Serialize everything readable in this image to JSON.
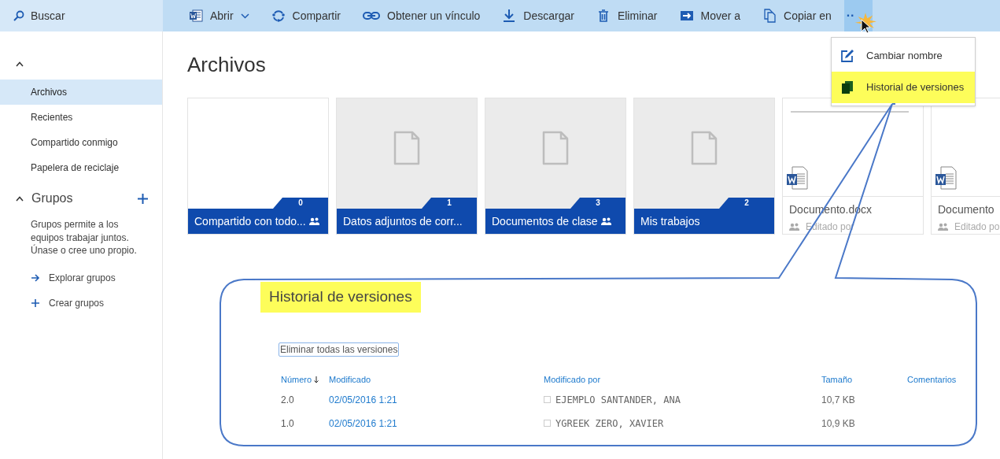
{
  "search": {
    "label": "Buscar"
  },
  "toolbar": [
    {
      "kind": "word",
      "label": "Abrir",
      "dropdown": true
    },
    {
      "kind": "share",
      "label": "Compartir",
      "dropdown": false
    },
    {
      "kind": "link",
      "label": "Obtener un vínculo",
      "dropdown": false
    },
    {
      "kind": "download",
      "label": "Descargar",
      "dropdown": false
    },
    {
      "kind": "trash",
      "label": "Eliminar",
      "dropdown": false
    },
    {
      "kind": "move",
      "label": "Mover a",
      "dropdown": false
    },
    {
      "kind": "copy",
      "label": "Copiar en",
      "dropdown": false
    },
    {
      "kind": "more",
      "label": "··",
      "dropdown": false
    }
  ],
  "menu": [
    {
      "kind": "edit",
      "label": "Cambiar nombre",
      "highlighted": false
    },
    {
      "kind": "versions",
      "label": "Historial de versiones",
      "highlighted": true
    }
  ],
  "sidebar": {
    "items": [
      {
        "label": "Archivos",
        "selected": true
      },
      {
        "label": "Recientes",
        "selected": false
      },
      {
        "label": "Compartido conmigo",
        "selected": false
      },
      {
        "label": "Papelera de reciclaje",
        "selected": false
      }
    ],
    "groups": {
      "title": "Grupos",
      "expanded": true,
      "description": "Grupos permite a los equipos trabajar juntos. Únase o cree uno propio.",
      "actions": [
        {
          "kind": "arrow",
          "label": "Explorar grupos"
        },
        {
          "kind": "plus",
          "label": "Crear grupos"
        }
      ]
    }
  },
  "page_title": "Archivos",
  "folders": [
    {
      "name": "Compartido con todo...",
      "count": "0",
      "shared": true,
      "empty": true
    },
    {
      "name": "Datos adjuntos de corr...",
      "count": "1",
      "shared": false,
      "empty": false
    },
    {
      "name": "Documentos de clase",
      "count": "3",
      "shared": true,
      "empty": false
    },
    {
      "name": "Mis trabajos",
      "count": "2",
      "shared": false,
      "empty": false
    }
  ],
  "documents": [
    {
      "name": "Documento.docx",
      "status": "Editado por"
    },
    {
      "name": "Documento",
      "status": "Editado po"
    }
  ],
  "callout": {
    "title": "Historial de versiones",
    "highlighted": true,
    "delete_all": "Eliminar todas las versiones",
    "columns": [
      "Número",
      "Modificado",
      "Modificado por",
      "Tamaño",
      "Comentarios"
    ],
    "rows": [
      {
        "number": "2.0",
        "modified": "02/05/2016 1:21",
        "checked": false,
        "modified_by": "EJEMPLO SANTANDER, ANA",
        "size": "10,7 KB"
      },
      {
        "number": "1.0",
        "modified": "02/05/2016 1:21",
        "checked": false,
        "modified_by": "YGREEK ZERO, XAVIER",
        "size": "10,9 KB"
      }
    ]
  }
}
